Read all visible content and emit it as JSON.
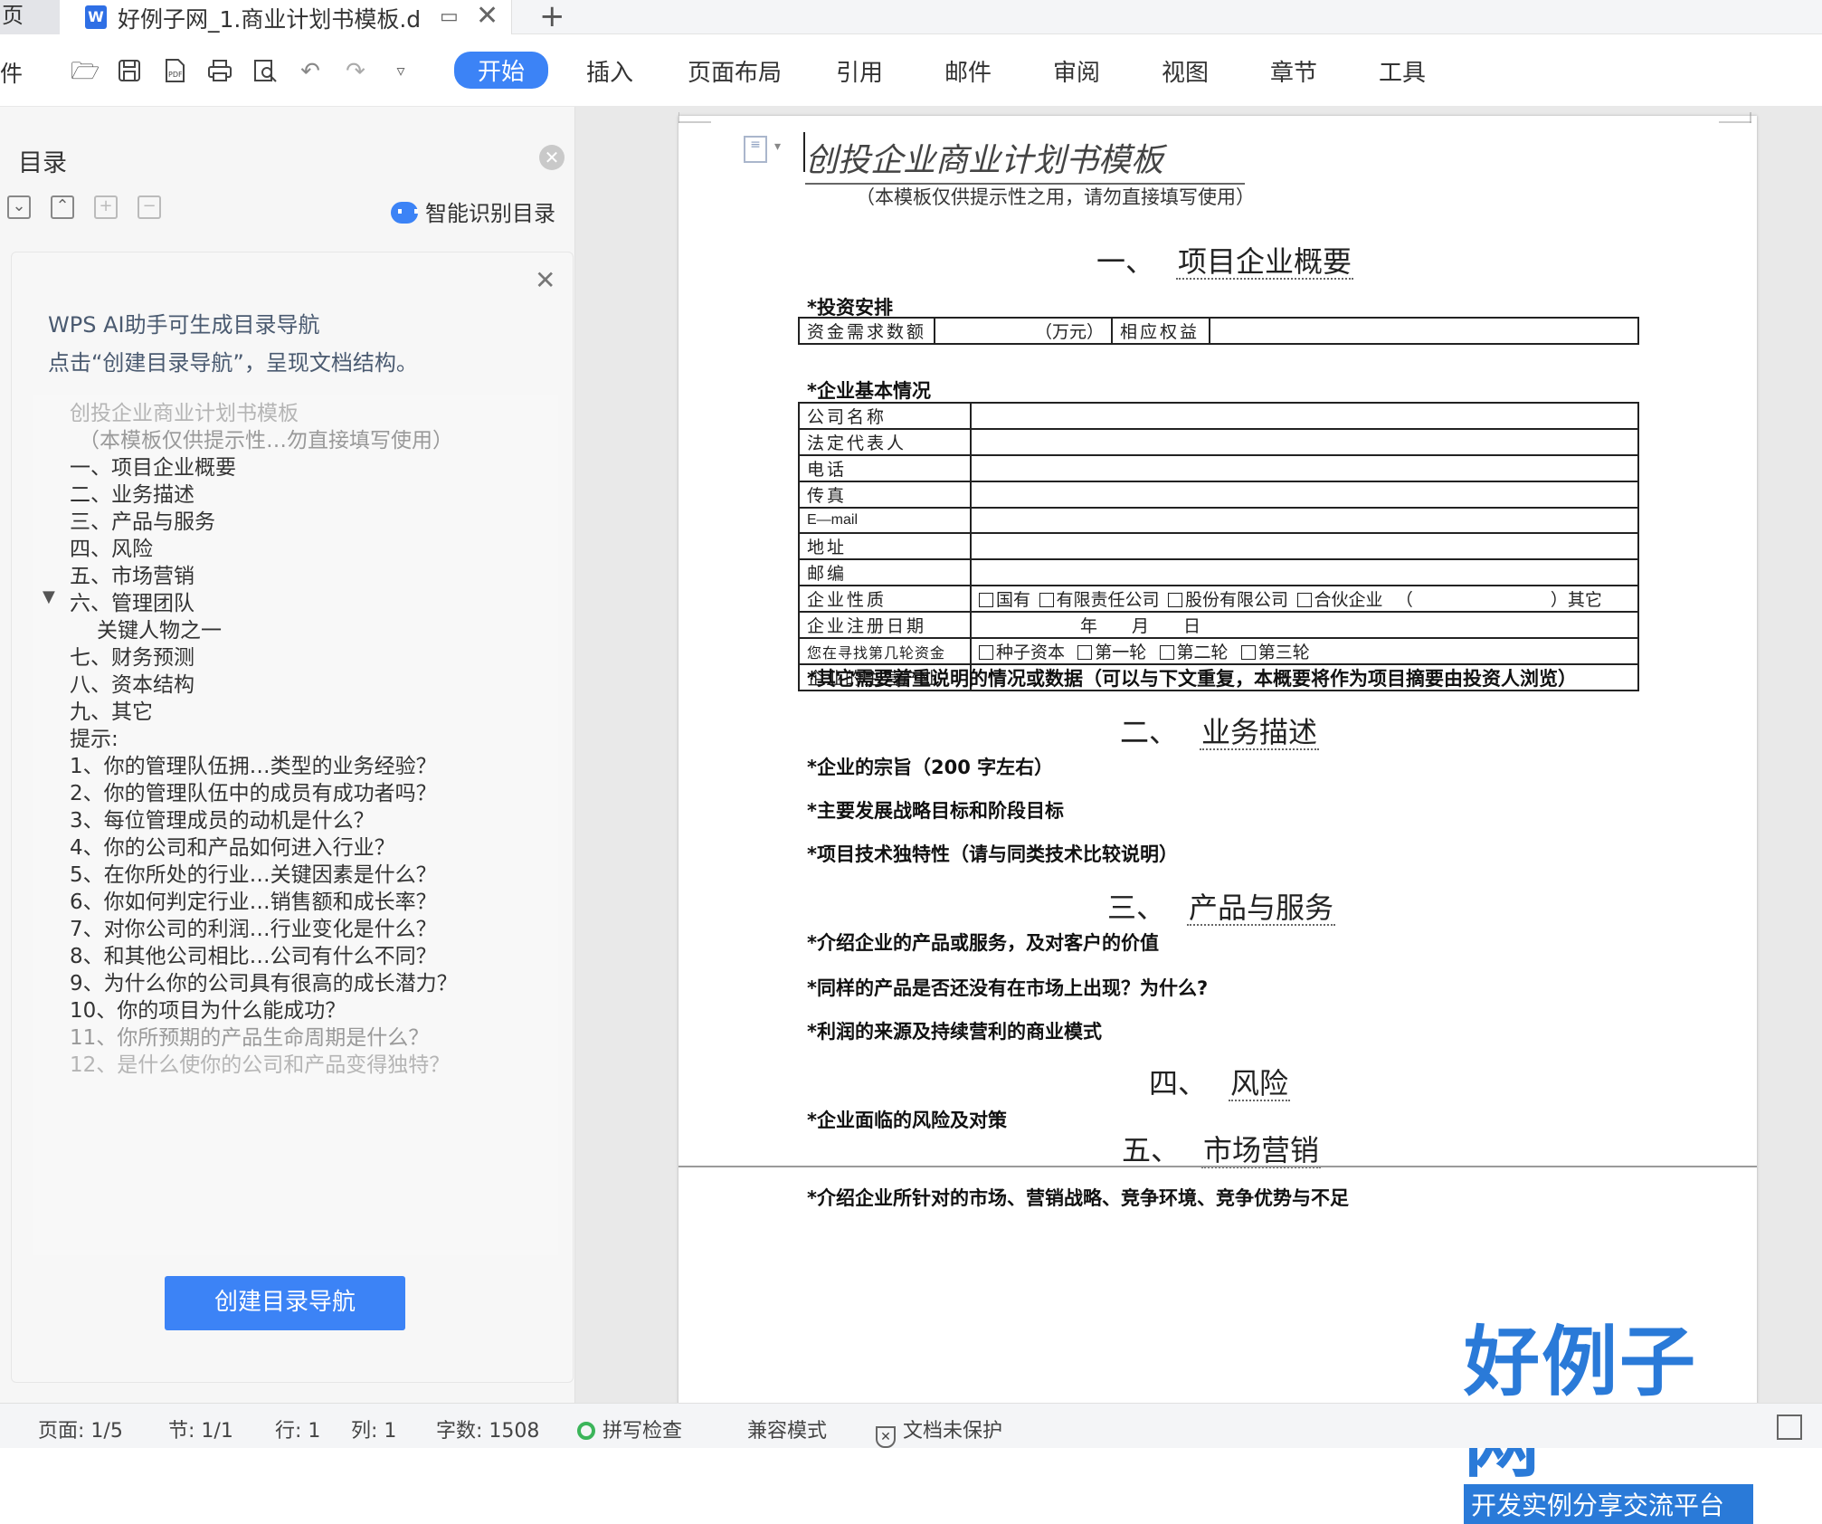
{
  "tabs": {
    "home_label": "页",
    "doc_icon": "W",
    "doc_title": "好例子网_1.商业计划书模板.d",
    "add": "+",
    "close": "✕"
  },
  "ribbon": {
    "file_label": "件",
    "menus": [
      "开始",
      "插入",
      "页面布局",
      "引用",
      "邮件",
      "审阅",
      "视图",
      "章节",
      "工具"
    ],
    "active_menu": "开始"
  },
  "nav": {
    "title": "目录",
    "smart_label": "智能识别目录",
    "ai_line1": "WPS AI助手可生成目录导航",
    "ai_line2": "点击“创建目录导航”，呈现文档结构。",
    "toc": [
      "创投企业商业计划书模板",
      "（本模板仅供提示性…勿直接填写使用）",
      "一、项目企业概要",
      "二、业务描述",
      "三、产品与服务",
      "四、风险",
      "五、市场营销",
      "六、管理团队",
      "关键人物之一",
      "七、财务预测",
      "八、资本结构",
      "九、其它",
      "提示:",
      "1、你的管理队伍拥…类型的业务经验？",
      "2、你的管理队伍中的成员有成功者吗？",
      "3、每位管理成员的动机是什么？",
      "4、你的公司和产品如何进入行业？",
      "5、在你所处的行业…关键因素是什么？",
      "6、你如何判定行业…销售额和成长率？",
      "7、对你公司的利润…行业变化是什么？",
      "8、和其他公司相比…公司有什么不同？",
      "9、为什么你的公司具有很高的成长潜力？",
      "10、你的项目为什么能成功？",
      "11、你所预期的产品生命周期是什么？",
      "12、是什么使你的公司和产品变得独特？"
    ],
    "create_button": "创建目录导航"
  },
  "document": {
    "title": "创投企业商业计划书模板",
    "note": "（本模板仅供提示性之用，请勿直接填写使用）",
    "sec1_num": "一、",
    "sec1_title": "项目企业概要",
    "invest_label": "*投资安排",
    "invest_row": [
      "资金需求数额",
      "（万元）",
      "相应权益",
      ""
    ],
    "basic_label": "*企业基本情况",
    "basic_rows": [
      {
        "k": "公司名称",
        "v": ""
      },
      {
        "k": "法定代表人",
        "v": ""
      },
      {
        "k": "电话",
        "v": ""
      },
      {
        "k": "传真",
        "v": ""
      },
      {
        "k": "E—mail",
        "v": ""
      },
      {
        "k": "地址",
        "v": ""
      },
      {
        "k": "邮编",
        "v": ""
      }
    ],
    "nature_label": "企业性质",
    "nature_opts": [
      "国有",
      "有限责任公司",
      "股份有限公司",
      "合伙企业"
    ],
    "nature_other": "（　　　　　　　　）其它",
    "reg_label": "企业注册日期",
    "reg_value": "年　　月　　日",
    "round_label": "您在寻找第几轮资金",
    "round_opts": [
      "种子资本",
      "第一轮",
      "第二轮",
      "第三轮"
    ],
    "industry_label": "企业的主营产业",
    "other_note": "*其它需要着重说明的情况或数据（可以与下文重复，本概要将作为项目摘要由投资人浏览）",
    "sec2_num": "二、",
    "sec2_title": "业务描述",
    "q_purpose": "*企业的宗旨（200 字左右）",
    "q_strategy": "*主要发展战略目标和阶段目标",
    "q_tech": "*项目技术独特性（请与同类技术比较说明）",
    "sec3_num": "三、",
    "sec3_title": "产品与服务",
    "q_product": "*介绍企业的产品或服务，及对客户的价值",
    "q_market_absent": "*同样的产品是否还没有在市场上出现？为什么?",
    "q_profit": "*利润的来源及持续营利的商业模式",
    "sec4_num": "四、",
    "sec4_title": "风险",
    "q_risk": "*企业面临的风险及对策",
    "sec5_num": "五、",
    "sec5_title": "市场营销",
    "q_marketing": "*介绍企业所针对的市场、营销战略、竞争环境、竞争优势与不足"
  },
  "brand": {
    "big": "好例子网",
    "sub": "开发实例分享交流平台"
  },
  "status": {
    "page": "页面: 1/5",
    "section": "节: 1/1",
    "row": "行: 1",
    "col": "列: 1",
    "words": "字数: 1508",
    "spell": "拼写检查",
    "compat": "兼容模式",
    "protect": "文档未保护"
  },
  "colors": {
    "accent": "#3c83f6",
    "brand": "#2a7ad8",
    "spell_ok": "#3bb55a"
  }
}
